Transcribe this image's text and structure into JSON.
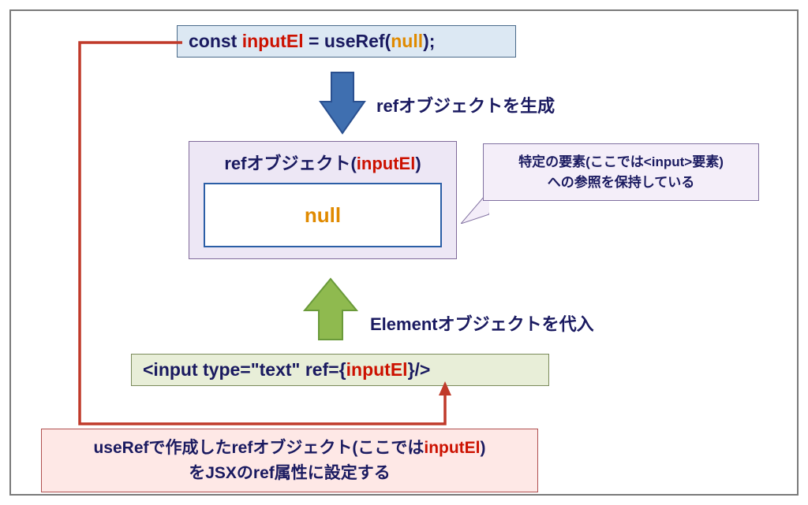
{
  "code1": {
    "const": "const ",
    "var": "inputEl",
    "eq": " = useRef(",
    "null": "null",
    "end": ");"
  },
  "label1": "refオブジェクトを生成",
  "refObj": {
    "prefix": "refオブジェクト(",
    "var": "inputEl",
    "suffix": ")"
  },
  "nullValue": "null",
  "callout": {
    "line1": "特定の要素(ここでは<input>要素)",
    "line2": "への参照を保持している"
  },
  "label2": "Elementオブジェクトを代入",
  "code2": {
    "prefix": "<input type=\"text\" ref={",
    "var": "inputEl",
    "suffix": "}/>"
  },
  "note": {
    "line1a": "useRefで作成したrefオブジェクト(ここでは",
    "line1b": "inputEl",
    "line1c": ")",
    "line2": "をJSXのref属性に設定する"
  }
}
